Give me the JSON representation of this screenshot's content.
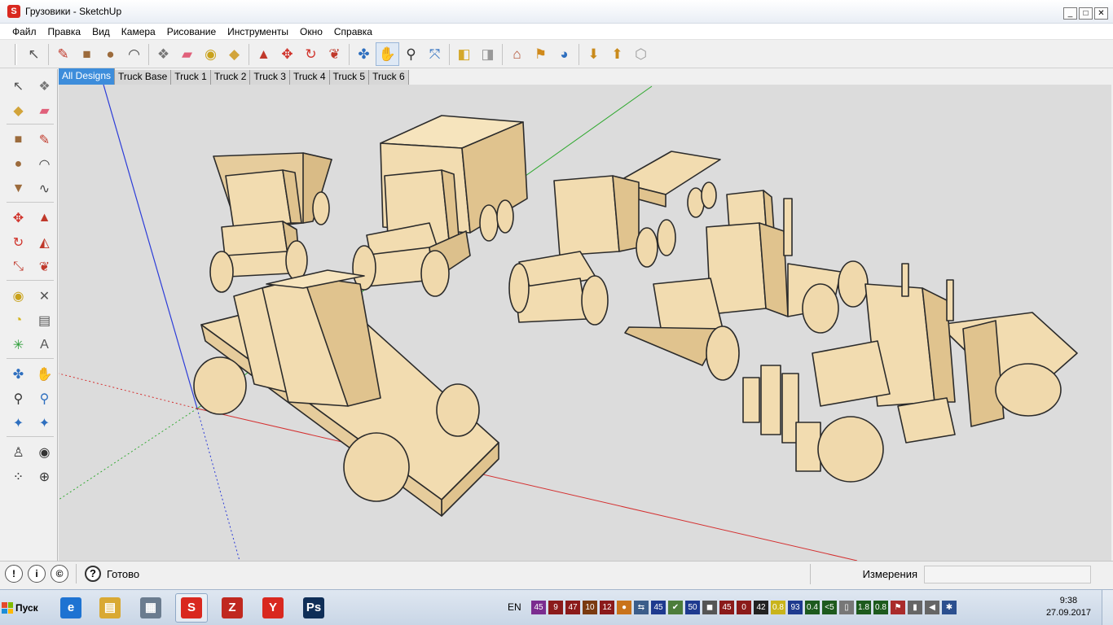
{
  "window": {
    "title": "Грузовики - SketchUp",
    "controls": [
      "_",
      "□",
      "✕"
    ]
  },
  "menu": [
    "Файл",
    "Правка",
    "Вид",
    "Камера",
    "Рисование",
    "Инструменты",
    "Окно",
    "Справка"
  ],
  "toolbar": {
    "groups": [
      [
        {
          "name": "select-icon",
          "glyph": "↖",
          "color": "#555555"
        }
      ],
      [
        {
          "name": "pencil-icon",
          "glyph": "✎",
          "color": "#c0392b"
        },
        {
          "name": "rectangle-icon",
          "glyph": "■",
          "color": "#9c6b3c"
        },
        {
          "name": "circle-icon",
          "glyph": "●",
          "color": "#9c6b3c"
        },
        {
          "name": "arc-icon",
          "glyph": "◠",
          "color": "#444444"
        }
      ],
      [
        {
          "name": "make-component-icon",
          "glyph": "❖",
          "color": "#777777"
        },
        {
          "name": "eraser-icon",
          "glyph": "▰",
          "color": "#e0607a"
        },
        {
          "name": "tape-measure-icon",
          "glyph": "◉",
          "color": "#c9a21b"
        },
        {
          "name": "paint-bucket-icon",
          "glyph": "◆",
          "color": "#d2a43a"
        }
      ],
      [
        {
          "name": "push-pull-icon",
          "glyph": "▲",
          "color": "#c0392b"
        },
        {
          "name": "move-icon",
          "glyph": "✥",
          "color": "#d0332b"
        },
        {
          "name": "rotate-icon",
          "glyph": "↻",
          "color": "#d0332b"
        },
        {
          "name": "offset-icon",
          "glyph": "❦",
          "color": "#c0392b"
        }
      ],
      [
        {
          "name": "orbit-icon",
          "glyph": "✤",
          "color": "#2e6fbf"
        },
        {
          "name": "pan-icon",
          "glyph": "✋",
          "color": "#555555"
        },
        {
          "name": "zoom-icon",
          "glyph": "⚲",
          "color": "#333333"
        },
        {
          "name": "zoom-extents-icon",
          "glyph": "⤧",
          "color": "#2e6fbf"
        }
      ],
      [
        {
          "name": "previous-view-icon",
          "glyph": "◧",
          "color": "#d4a82b"
        },
        {
          "name": "next-view-icon",
          "glyph": "◨",
          "color": "#999999"
        }
      ],
      [
        {
          "name": "warehouse-icon",
          "glyph": "⌂",
          "color": "#b04a2b"
        },
        {
          "name": "add-location-icon",
          "glyph": "⚑",
          "color": "#d08a1b"
        },
        {
          "name": "google-earth-icon",
          "glyph": "◕",
          "color": "#2e6fbf"
        }
      ],
      [
        {
          "name": "get-models-icon",
          "glyph": "⬇",
          "color": "#c98a1b"
        },
        {
          "name": "share-model-icon",
          "glyph": "⬆",
          "color": "#c98a1b"
        },
        {
          "name": "share-component-icon",
          "glyph": "⬡",
          "color": "#999999"
        }
      ]
    ]
  },
  "left_tools": [
    [
      {
        "name": "select-icon",
        "glyph": "↖",
        "color": "#555555"
      },
      {
        "name": "make-component-icon",
        "glyph": "❖",
        "color": "#777777"
      }
    ],
    [
      {
        "name": "paint-bucket-icon",
        "glyph": "◆",
        "color": "#d2a43a"
      },
      {
        "name": "eraser-icon",
        "glyph": "▰",
        "color": "#e0607a"
      }
    ],
    "gap",
    [
      {
        "name": "rectangle-icon",
        "glyph": "■",
        "color": "#9c6b3c"
      },
      {
        "name": "pencil-icon",
        "glyph": "✎",
        "color": "#c0392b"
      }
    ],
    [
      {
        "name": "circle-icon",
        "glyph": "●",
        "color": "#9c6b3c"
      },
      {
        "name": "arc-icon",
        "glyph": "◠",
        "color": "#444444"
      }
    ],
    [
      {
        "name": "polygon-icon",
        "glyph": "▼",
        "color": "#9c6b3c"
      },
      {
        "name": "freehand-icon",
        "glyph": "∿",
        "color": "#444444"
      }
    ],
    "gap",
    [
      {
        "name": "move-icon",
        "glyph": "✥",
        "color": "#d0332b"
      },
      {
        "name": "push-pull-icon",
        "glyph": "▲",
        "color": "#c0392b"
      }
    ],
    [
      {
        "name": "rotate-icon",
        "glyph": "↻",
        "color": "#d0332b"
      },
      {
        "name": "follow-me-icon",
        "glyph": "◭",
        "color": "#c0392b"
      }
    ],
    [
      {
        "name": "scale-icon",
        "glyph": "⤡",
        "color": "#c0392b"
      },
      {
        "name": "offset-icon",
        "glyph": "❦",
        "color": "#c0392b"
      }
    ],
    "gap",
    [
      {
        "name": "tape-measure-icon",
        "glyph": "◉",
        "color": "#c9a21b"
      },
      {
        "name": "dimension-icon",
        "glyph": "✕",
        "color": "#555555"
      }
    ],
    [
      {
        "name": "protractor-icon",
        "glyph": "◔",
        "color": "#d4b41b"
      },
      {
        "name": "text-icon",
        "glyph": "▤",
        "color": "#555555"
      }
    ],
    [
      {
        "name": "axes-icon",
        "glyph": "✳",
        "color": "#2e9f3b"
      },
      {
        "name": "3d-text-icon",
        "glyph": "A",
        "color": "#555555"
      }
    ],
    "gap",
    [
      {
        "name": "orbit-icon",
        "glyph": "✤",
        "color": "#2e6fbf"
      },
      {
        "name": "pan-icon",
        "glyph": "✋",
        "color": "#555555"
      }
    ],
    [
      {
        "name": "zoom-icon",
        "glyph": "⚲",
        "color": "#333333"
      },
      {
        "name": "zoom-window-icon",
        "glyph": "⚲",
        "color": "#2e6fbf"
      }
    ],
    [
      {
        "name": "zoom-extents-icon",
        "glyph": "✦",
        "color": "#2e6fbf"
      },
      {
        "name": "previous-icon",
        "glyph": "✦",
        "color": "#2e6fbf"
      }
    ],
    "gap",
    [
      {
        "name": "position-camera-icon",
        "glyph": "♙",
        "color": "#333333"
      },
      {
        "name": "look-around-icon",
        "glyph": "◉",
        "color": "#333333"
      }
    ],
    [
      {
        "name": "walk-icon",
        "glyph": "⁘",
        "color": "#111111"
      },
      {
        "name": "section-plane-icon",
        "glyph": "⊕",
        "color": "#333333"
      }
    ]
  ],
  "tabs": [
    "All Designs",
    "Truck Base",
    "Truck 1",
    "Truck 2",
    "Truck 3",
    "Truck 4",
    "Truck 5",
    "Truck 6"
  ],
  "active_tab": 0,
  "viewport": {
    "background": "#dcdcdc",
    "wood": "#f2dcb0",
    "wood_shade": "#e0c38e",
    "outline": "#2b2b2b"
  },
  "status": {
    "text": "Готово",
    "measure_label": "Измерения",
    "measure_value": "",
    "circles": [
      "!",
      "i",
      "©"
    ]
  },
  "taskbar": {
    "start_label": "Пуск",
    "language": "EN",
    "clock_time": "9:38",
    "clock_date": "27.09.2017",
    "apps": [
      {
        "name": "taskbar-ie",
        "glyph": "e",
        "color": "#1e73d2"
      },
      {
        "name": "taskbar-explorer",
        "glyph": "▤",
        "color": "#d9a933"
      },
      {
        "name": "taskbar-calculator",
        "glyph": "▦",
        "color": "#6b7c8f"
      },
      {
        "name": "taskbar-sketchup",
        "glyph": "S",
        "color": "#d9281f"
      },
      {
        "name": "taskbar-filezilla",
        "glyph": "Z",
        "color": "#c0281f"
      },
      {
        "name": "taskbar-yandex",
        "glyph": "Y",
        "color": "#d9281f"
      },
      {
        "name": "taskbar-photoshop",
        "glyph": "Ps",
        "color": "#0f2e57"
      }
    ],
    "tray": [
      {
        "text": "45",
        "bg": "#7b2c8f"
      },
      {
        "text": "9",
        "bg": "#8b1a1a"
      },
      {
        "text": "47",
        "bg": "#8b1a1a"
      },
      {
        "text": "10",
        "bg": "#7a3a10"
      },
      {
        "text": "12",
        "bg": "#8b1a1a"
      },
      {
        "text": "●",
        "bg": "#c9731b"
      },
      {
        "text": "⇆",
        "bg": "#3b5d8a"
      },
      {
        "text": "45",
        "bg": "#1e3a8f"
      },
      {
        "text": "✔",
        "bg": "#4d7d3a"
      },
      {
        "text": "50",
        "bg": "#1e3a8f"
      },
      {
        "text": "◼",
        "bg": "#555555"
      },
      {
        "text": "45",
        "bg": "#8b1a1a"
      },
      {
        "text": "0",
        "bg": "#8b1a1a"
      },
      {
        "text": "42",
        "bg": "#222222"
      },
      {
        "text": "0.8",
        "bg": "#c9b41b"
      },
      {
        "text": "93",
        "bg": "#1e3a8f"
      },
      {
        "text": "0.4",
        "bg": "#1d5a1d"
      },
      {
        "text": "<5",
        "bg": "#1d5a1d"
      },
      {
        "text": "▯",
        "bg": "#777777"
      },
      {
        "text": "1.8",
        "bg": "#1d5a1d"
      },
      {
        "text": "0.8",
        "bg": "#1d5a1d"
      },
      {
        "text": "⚑",
        "bg": "#aa2b2b"
      },
      {
        "text": "▮",
        "bg": "#666666"
      },
      {
        "text": "◀",
        "bg": "#666666"
      },
      {
        "text": "✱",
        "bg": "#2b4f8f"
      }
    ]
  }
}
